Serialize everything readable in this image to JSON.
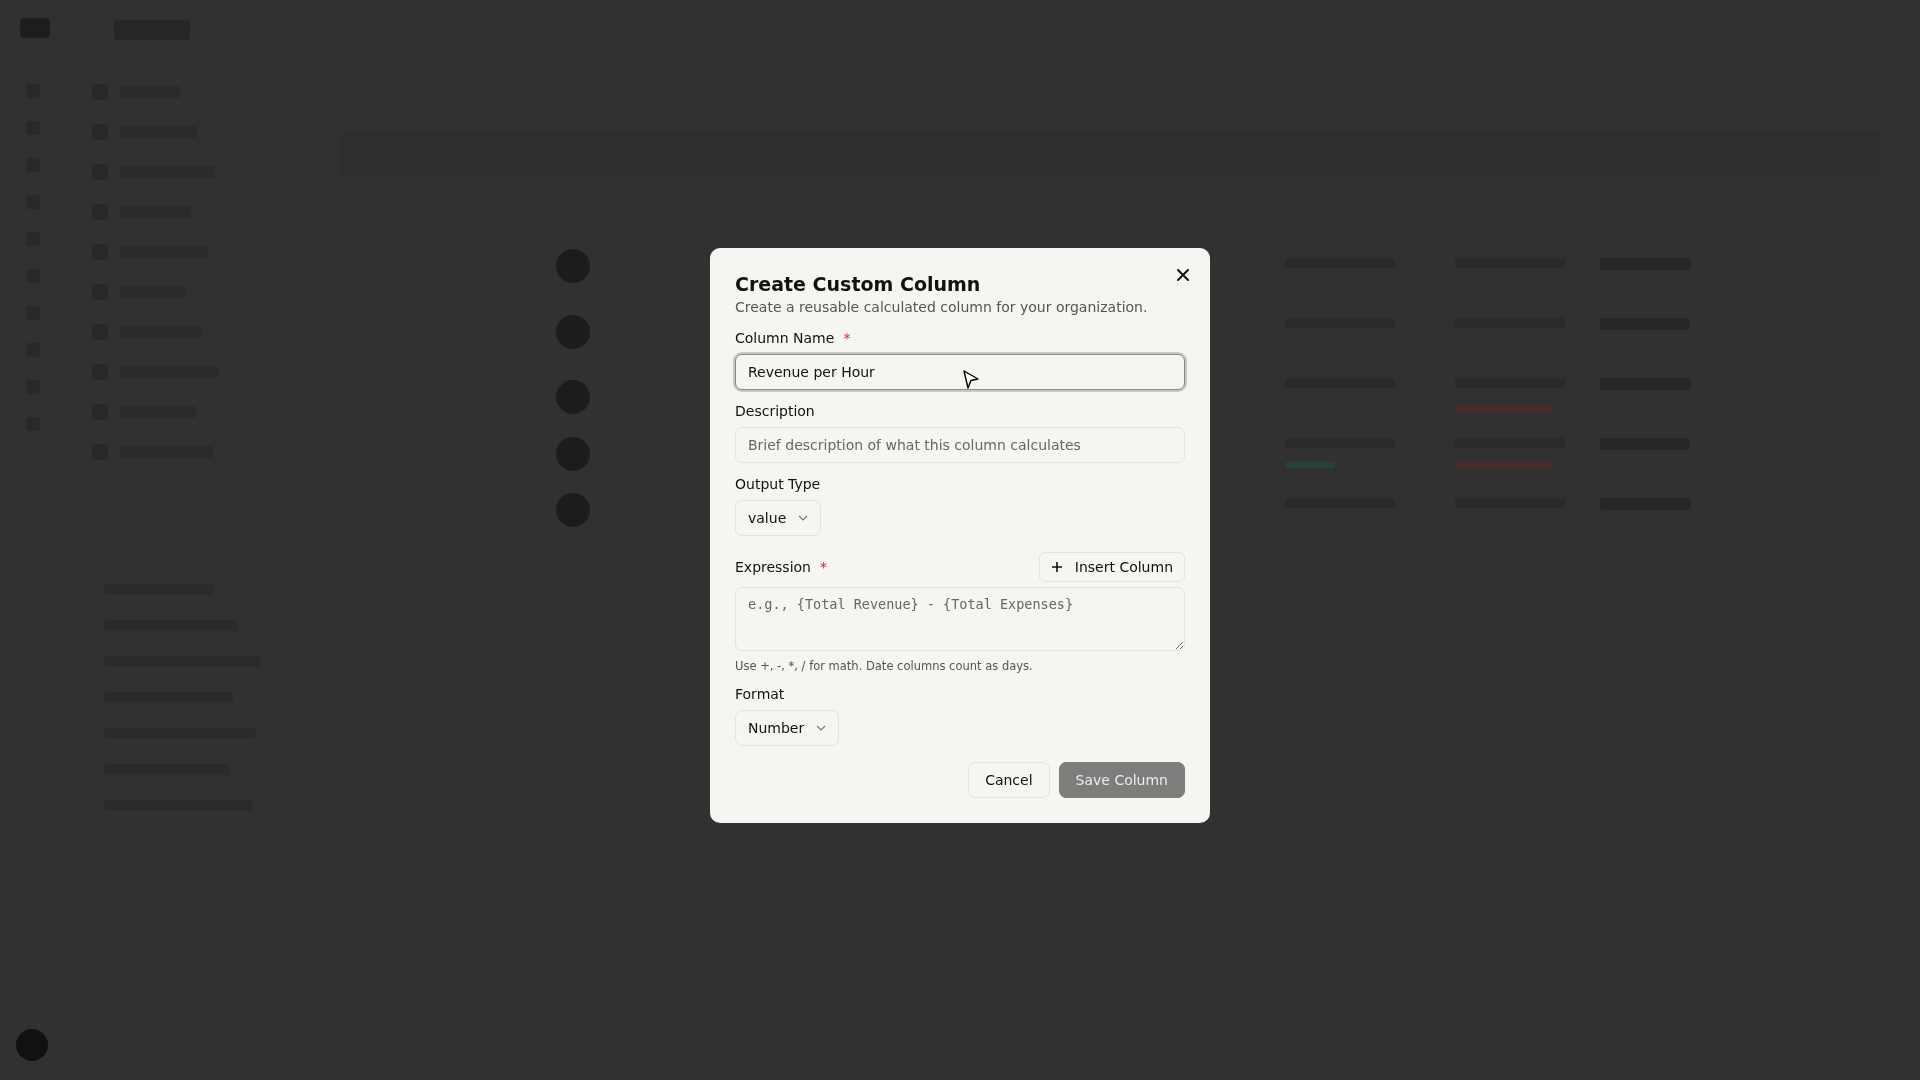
{
  "dialog": {
    "title": "Create Custom Column",
    "subtitle": "Create a reusable calculated column for your organization.",
    "fields": [
      {
        "kind": "text",
        "label": "Column Name",
        "marker": "*",
        "value": "Revenue per Hour",
        "focused": true
      },
      {
        "kind": "text",
        "label": "Description",
        "placeholder": "Brief description of what this column calculates",
        "focused": false
      },
      {
        "kind": "select",
        "label": "Output Type",
        "value": "value"
      },
      {
        "kind": "textarea",
        "label": "Expression",
        "marker": "*",
        "action": "Insert Column",
        "placeholder": "e.g., {Total Revenue} - {Total Expenses}",
        "hint": "Use +, -, *, / for math. Date columns count as days."
      },
      {
        "kind": "select",
        "label": "Format",
        "value": "Number"
      }
    ],
    "buttons": [
      {
        "label": "Cancel",
        "kind": "secondary",
        "disabled": false
      },
      {
        "label": "Save Column",
        "kind": "primary",
        "disabled": true
      }
    ]
  }
}
